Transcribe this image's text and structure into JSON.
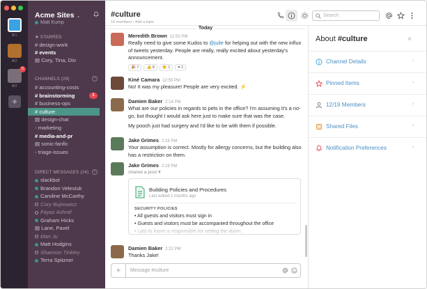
{
  "colors": {
    "team_rail": "#2b2330",
    "sidebar": "#4d394b",
    "active_channel": "#4c9689",
    "badge": "#e8474f",
    "link": "#4a8fc4",
    "mention": "#2a80b9"
  },
  "team_rail": {
    "teams": [
      {
        "label": "⌘1",
        "color": "#3aa3e3"
      },
      {
        "label": "⌘2",
        "color": "#b0712e"
      },
      {
        "label": "⌘3",
        "color": "#7a6f78",
        "badge": "5"
      }
    ],
    "add_icon": "plus-icon"
  },
  "sidebar": {
    "team_name": "Acme Sites",
    "chevron": "⌄",
    "user": "Matt Kump",
    "starred_header": "★ STARRED",
    "starred": [
      {
        "label": "# design-work",
        "style": "normal"
      },
      {
        "label": "# events",
        "style": "bold"
      },
      {
        "label": "▤ Cory, Tina, Dio",
        "style": "normal"
      }
    ],
    "channels_header": "CHANNELS",
    "channels_count": "(29)",
    "channels": [
      {
        "label": "# accounting-costs",
        "style": "normal"
      },
      {
        "label": "# brainstorming",
        "style": "bold",
        "badge": "1"
      },
      {
        "label": "# business-ops",
        "style": "normal"
      },
      {
        "label": "# culture",
        "style": "active"
      },
      {
        "label": "▤ design-chat",
        "style": "normal"
      },
      {
        "label": "◦ marketing",
        "style": "normal"
      },
      {
        "label": "# media-and-pr",
        "style": "bold"
      },
      {
        "label": "▤ sonic-fanfic",
        "style": "normal"
      },
      {
        "label": "◦ triage-issues",
        "style": "normal"
      }
    ],
    "dm_header": "DIRECT MESSAGES",
    "dm_count": "(24)",
    "dms": [
      {
        "label": "slackbot",
        "status": "on",
        "italic": false
      },
      {
        "label": "Brandon Velestuk",
        "status": "on",
        "italic": false
      },
      {
        "label": "Caroline McCarthy",
        "status": "on",
        "italic": false
      },
      {
        "label": "Cory Bujnowicz",
        "status": "off",
        "italic": true
      },
      {
        "label": "Fayaz Ashraf",
        "status": "off",
        "italic": true
      },
      {
        "label": "Graham Hicks",
        "status": "on",
        "italic": false
      },
      {
        "label": "Lane, Pavel",
        "status": "group",
        "italic": false
      },
      {
        "label": "Mari Ju",
        "status": "off",
        "italic": true
      },
      {
        "label": "Matt Hodgins",
        "status": "on",
        "italic": false
      },
      {
        "label": "Shannon Tinkley",
        "status": "off",
        "italic": true
      },
      {
        "label": "Terra Spitzner",
        "status": "on",
        "italic": false
      }
    ]
  },
  "header": {
    "channel": "#culture",
    "members": "19 members",
    "separator": "|",
    "topic": "Add a topic",
    "search_placeholder": "Search"
  },
  "messages": {
    "day_label": "Today",
    "items": [
      {
        "author": "Meredith Brown",
        "time": "12:50 PM",
        "avatar": "#c96a5a",
        "text_before": "Really need to give some Kudos to ",
        "mention": "@julie",
        "text_after": " for helping out with the new influx of tweets yesterday. People are really, really excited about yesterday's announcement.",
        "reactions": [
          "🎉 7",
          "👍 8",
          "👏 1",
          "♥ 2"
        ]
      },
      {
        "author": "Kiné Camara",
        "time": "12:55 PM",
        "avatar": "#6b4a3a",
        "text": "No! It was my pleasure! People are very excited. ⚡"
      },
      {
        "author": "Damien Baker",
        "time": "2:14 PM",
        "avatar": "#8a6a4a",
        "text": "What are our policies in regards to pets in the office? I'm assuming it's a no-go, but thought I would ask here just to make sure that was the case.",
        "text2": "My pooch just had surgery and I'd like to be with them if possible."
      },
      {
        "author": "Jake Grimes",
        "time": "2:19 PM",
        "avatar": "#5a7a5a",
        "text": "Your assumption is correct. Mostly for allergy concerns, but the building also has a restriction on them."
      },
      {
        "author": "Jake Grimes",
        "time": "2:19 PM",
        "avatar": "#5a7a5a",
        "text": "shared a post ▾"
      },
      {
        "author": "Damien Baker",
        "time": "2:22 PM",
        "avatar": "#8a6a4a",
        "text": "Thanks Jake!"
      }
    ],
    "post": {
      "title": "Building Policies and Procedures",
      "subtitle": "Last edited 2 months ago",
      "section": "SECURITY POLICIES",
      "bullets": [
        "• All guests and visitors must sign in",
        "• Guests and visitors must be accompanied throughout the office",
        "• Last to leave is responsible for setting the alarm."
      ]
    }
  },
  "composer": {
    "plus": "+",
    "placeholder": "Message #culture"
  },
  "flexpane": {
    "title_prefix": "About ",
    "title_channel": "#culture",
    "close": "×",
    "rows": [
      {
        "label": "Channel Details",
        "icon": "info-icon",
        "color": "#3aa3e3"
      },
      {
        "label": "Pinned Items",
        "icon": "pin-icon",
        "color": "#e8474f"
      },
      {
        "label": "12/19 Members",
        "icon": "members-icon",
        "color": "#7b6f80"
      },
      {
        "label": "Shared Files",
        "icon": "files-icon",
        "color": "#e89a2e"
      },
      {
        "label": "Notification Preferences",
        "icon": "bell-icon",
        "color": "#e8474f"
      }
    ],
    "arrow": "›"
  }
}
